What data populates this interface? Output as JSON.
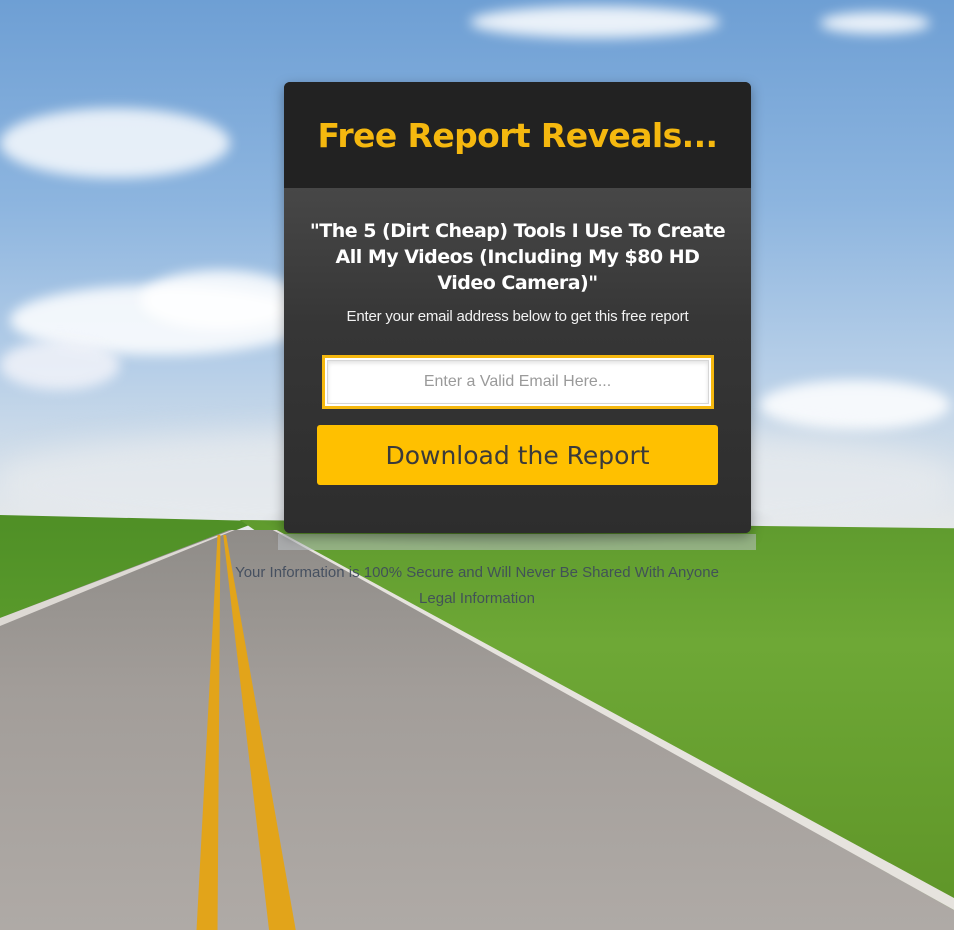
{
  "card": {
    "title": "Free Report Reveals...",
    "headline": "\"The 5 (Dirt Cheap) Tools I Use To Create All My Videos (Including My $80 HD Video Camera)\"",
    "subline": "Enter your email address below to get this free report"
  },
  "form": {
    "email_placeholder": "Enter a Valid Email Here...",
    "email_value": "",
    "submit_label": "Download the Report"
  },
  "footer": {
    "privacy_text": "Your Information is 100% Secure and Will Never Be Shared With Anyone",
    "legal_link": "Legal Information"
  },
  "colors": {
    "accent": "#f5b80f",
    "button": "#ffc000",
    "card_dark": "#222222"
  }
}
